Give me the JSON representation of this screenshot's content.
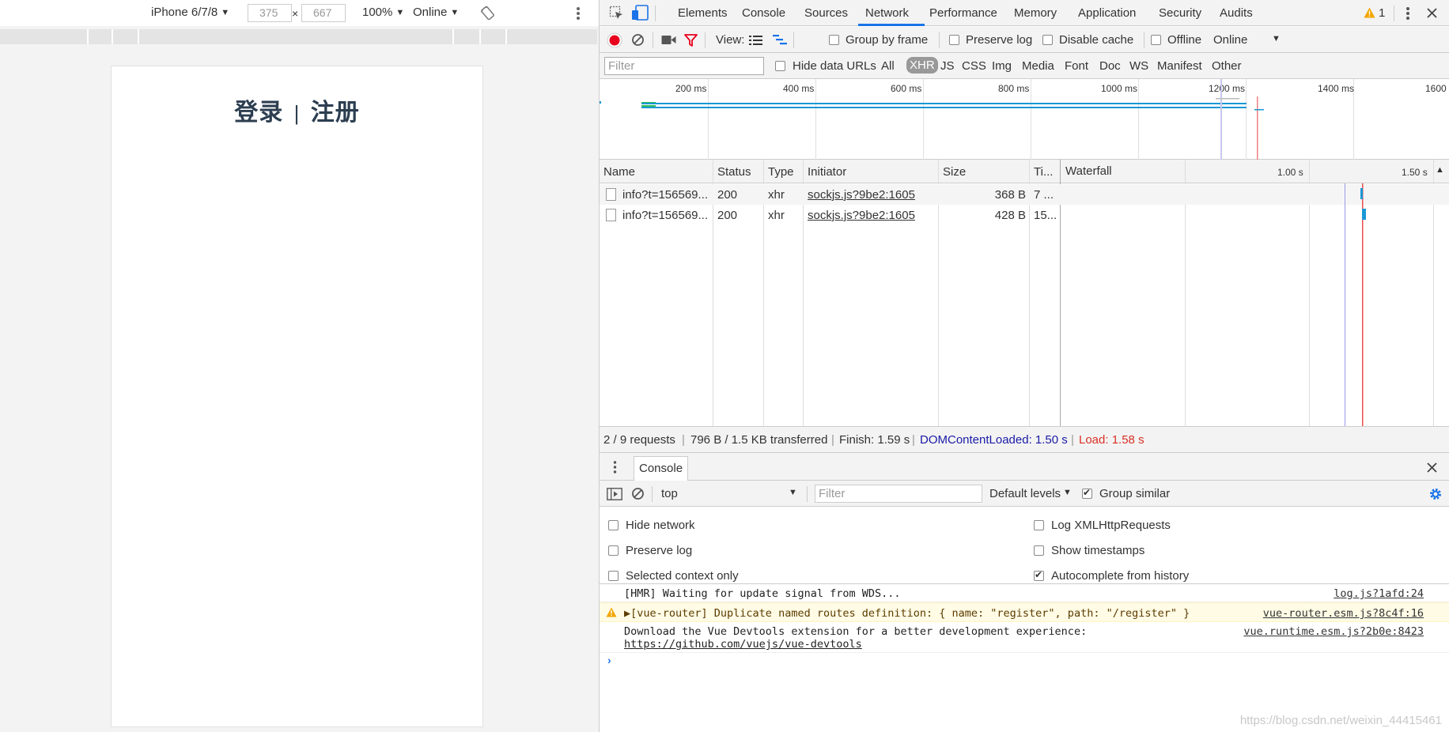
{
  "device_toolbar": {
    "device": "iPhone 6/7/8",
    "width": "375",
    "height": "667",
    "times": "×",
    "zoom": "100%",
    "network": "Online"
  },
  "page": {
    "title_login": "登录",
    "title_sep": "|",
    "title_register": "注册"
  },
  "devtools_tabs": {
    "items": [
      "Elements",
      "Console",
      "Sources",
      "Network",
      "Performance",
      "Memory",
      "Application",
      "Security",
      "Audits"
    ],
    "active": "Network",
    "warning_count": "1"
  },
  "network_toolbar": {
    "view_label": "View:",
    "group_by_frame": "Group by frame",
    "preserve_log": "Preserve log",
    "disable_cache": "Disable cache",
    "offline": "Offline",
    "throttle": "Online"
  },
  "filter_bar": {
    "placeholder": "Filter",
    "hide_data_urls": "Hide data URLs",
    "types": [
      "All",
      "XHR",
      "JS",
      "CSS",
      "Img",
      "Media",
      "Font",
      "Doc",
      "WS",
      "Manifest",
      "Other"
    ],
    "selected_type": "XHR"
  },
  "overview": {
    "ticks": [
      "200 ms",
      "400 ms",
      "600 ms",
      "800 ms",
      "1000 ms",
      "1200 ms",
      "1400 ms",
      "1600"
    ]
  },
  "table": {
    "headers": {
      "name": "Name",
      "status": "Status",
      "type": "Type",
      "initiator": "Initiator",
      "size": "Size",
      "time": "Ti...",
      "waterfall": "Waterfall"
    },
    "waterfall_ticks": [
      "1.00 s",
      "1.50 s"
    ],
    "rows": [
      {
        "name": "info?t=156569...",
        "status": "200",
        "type": "xhr",
        "initiator": "sockjs.js?9be2:1605",
        "size": "368 B",
        "time": "7 ..."
      },
      {
        "name": "info?t=156569...",
        "status": "200",
        "type": "xhr",
        "initiator": "sockjs.js?9be2:1605",
        "size": "428 B",
        "time": "15..."
      }
    ]
  },
  "status_bar": {
    "requests": "2 / 9 requests",
    "transferred": "796 B / 1.5 KB transferred",
    "finish": "Finish: 1.59 s",
    "dom_content_loaded": "DOMContentLoaded: 1.50 s",
    "load": "Load: 1.58 s",
    "dcl_color": "#1a1aa6",
    "load_color": "#d93025"
  },
  "drawer": {
    "tab": "Console"
  },
  "console_toolbar": {
    "context": "top",
    "filter_placeholder": "Filter",
    "levels": "Default levels",
    "group_similar": "Group similar"
  },
  "console_settings": {
    "hide_network": "Hide network",
    "preserve_log": "Preserve log",
    "selected_context_only": "Selected context only",
    "log_xhr": "Log XMLHttpRequests",
    "show_timestamps": "Show timestamps",
    "autocomplete": "Autocomplete from history"
  },
  "console_log": [
    {
      "text": "[HMR] Waiting for update signal from WDS...",
      "source": "log.js?1afd:24",
      "level": "info"
    },
    {
      "text": "▶[vue-router] Duplicate named routes definition: { name: \"register\", path: \"/register\" }",
      "source": "vue-router.esm.js?8c4f:16",
      "level": "warning"
    },
    {
      "text": "Download the Vue Devtools extension for a better development experience:",
      "link": "https://github.com/vuejs/vue-devtools",
      "source": "vue.runtime.esm.js?2b0e:8423",
      "level": "info"
    }
  ],
  "watermark": "https://blog.csdn.net/weixin_44415461"
}
